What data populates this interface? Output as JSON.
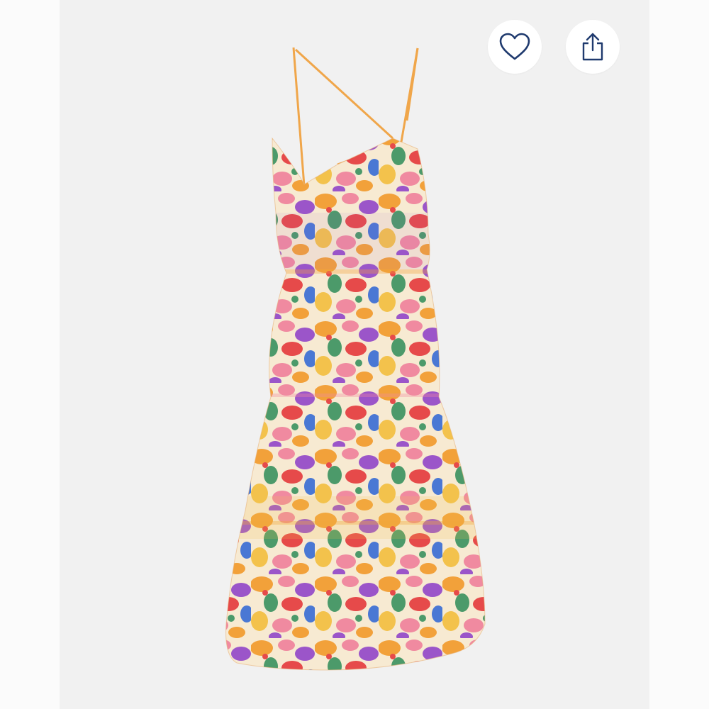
{
  "product": {
    "image_description_alt": "",
    "background": "#f1f1f1"
  },
  "actions": {
    "favorite_icon": "heart-outline-icon",
    "share_icon": "share-upload-icon",
    "icon_color": "#1f3a6e"
  },
  "palette": {
    "orange": "#f2a13a",
    "pink": "#f08aa0",
    "red": "#e64a4a",
    "purple": "#9b55c9",
    "blue": "#4a78d4",
    "green": "#4c9a6a",
    "cream": "#f7ead2",
    "yellow": "#f3c24c"
  }
}
